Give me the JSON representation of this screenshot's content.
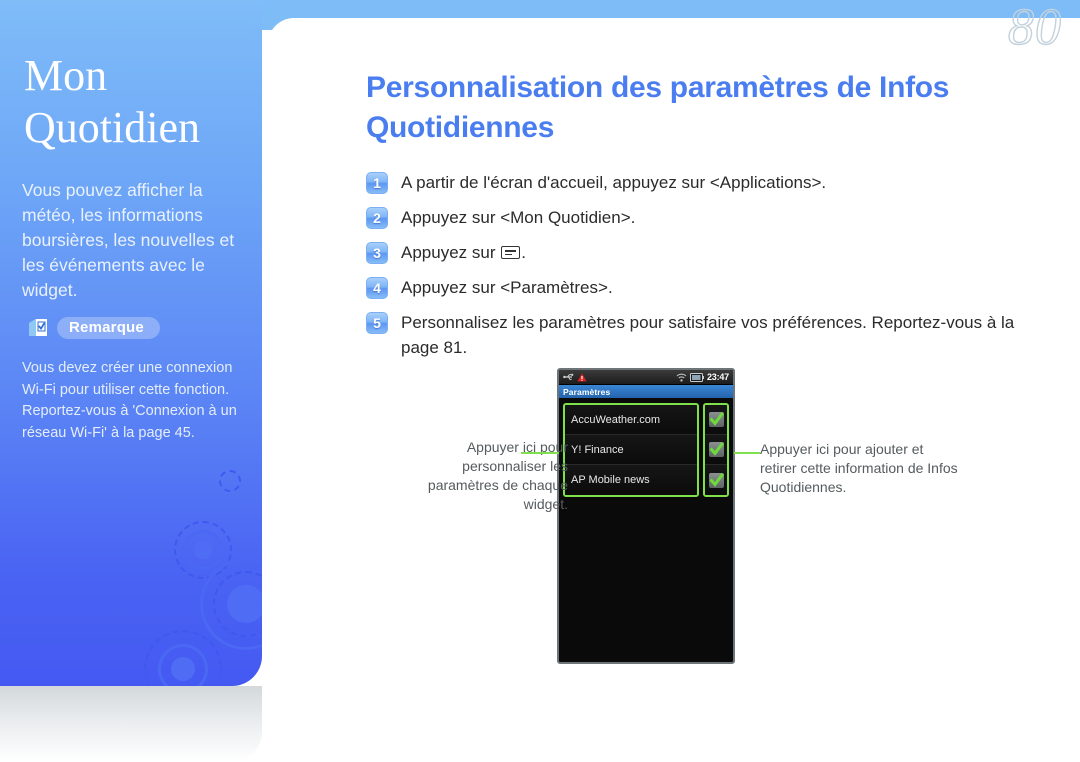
{
  "page": {
    "number": "80"
  },
  "sidebar": {
    "title_line1": "Mon",
    "title_line2": "Quotidien",
    "description": "Vous pouvez afficher la météo, les informations boursières, les nouvelles et les événements avec le widget.",
    "note_label": "Remarque",
    "note_icon": "note-box-check-icon",
    "note_text": "Vous devez créer une connexion Wi-Fi pour utiliser cette fonction. Reportez-vous à 'Connexion à un réseau Wi-Fi' à la page 45.",
    "accent_top": "#7fbcf8",
    "accent_bottom": "#4459f2"
  },
  "main": {
    "heading": "Personnalisation des paramètres de Infos Quotidiennes",
    "heading_color": "#4a7ef0",
    "steps": [
      {
        "num": "1",
        "text": "A partir de l'écran d'accueil, appuyez sur <Applications>."
      },
      {
        "num": "2",
        "text": "Appuyez sur <Mon Quotidien>."
      },
      {
        "num": "3",
        "text_before": "Appuyez sur ",
        "icon": "menu-icon",
        "text_after": "."
      },
      {
        "num": "4",
        "text": "Appuyez sur <Paramètres>."
      },
      {
        "num": "5",
        "text": "Personnalisez les paramètres pour satisfaire vos préférences. Reportez-vous à la page 81."
      }
    ]
  },
  "phone": {
    "status": {
      "usb_icon": "usb-icon",
      "warning_icon": "warning-triangle-icon",
      "wifi_icon": "wifi-icon",
      "battery_icon": "battery-icon",
      "time": "23:47"
    },
    "title": "Paramètres",
    "rows": [
      {
        "label": "AccuWeather.com",
        "checked": true
      },
      {
        "label": "Y! Finance",
        "checked": true
      },
      {
        "label": "AP Mobile news",
        "checked": true
      }
    ],
    "highlight_color": "#7ee04a",
    "check_color": "#6ed93a"
  },
  "callouts": {
    "left": "Appuyer ici pour personnaliser les paramètres de chaque widget.",
    "right": "Appuyer ici pour ajouter et retirer cette information de Infos Quotidiennes."
  }
}
